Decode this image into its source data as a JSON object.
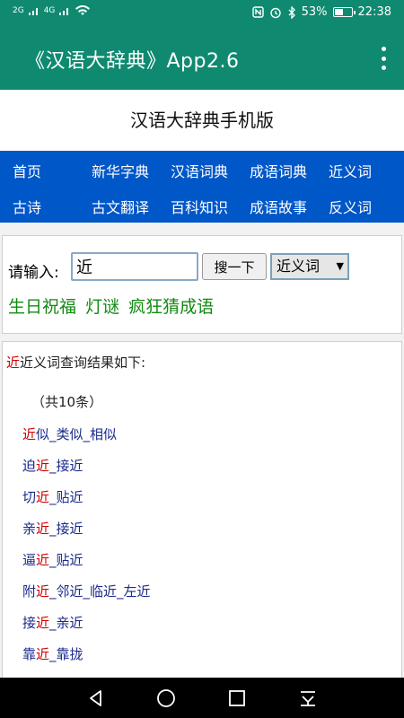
{
  "status_bar": {
    "left_indicators": [
      "2G",
      "4G"
    ],
    "battery_percent": "53%",
    "battery_level": 0.53,
    "time": "22:38"
  },
  "app_bar": {
    "title": "《汉语大辞典》App2.6"
  },
  "site_header": {
    "title": "汉语大辞典手机版"
  },
  "nav": {
    "row1": [
      "首页",
      "新华字典",
      "汉语词典",
      "成语词典",
      "近义词"
    ],
    "row2": [
      "古诗",
      "古文翻译",
      "百科知识",
      "成语故事",
      "反义词"
    ]
  },
  "search": {
    "label": "请输入:",
    "value": "近",
    "button_label": "搜一下",
    "selected_option": "近义词",
    "links": [
      "生日祝福",
      "灯谜",
      "疯狂猜成语"
    ]
  },
  "results": {
    "keyword": "近",
    "title_suffix": "近义词查询结果如下:",
    "count_text": "（共10条）",
    "items": [
      [
        {
          "t": "近",
          "k": true
        },
        {
          "t": "似_类似_相似",
          "k": false
        }
      ],
      [
        {
          "t": "迫",
          "k": false
        },
        {
          "t": "近",
          "k": true
        },
        {
          "t": "_接近",
          "k": false
        }
      ],
      [
        {
          "t": "切",
          "k": false
        },
        {
          "t": "近",
          "k": true
        },
        {
          "t": "_贴近",
          "k": false
        }
      ],
      [
        {
          "t": "亲",
          "k": false
        },
        {
          "t": "近",
          "k": true
        },
        {
          "t": "_接近",
          "k": false
        }
      ],
      [
        {
          "t": "逼",
          "k": false
        },
        {
          "t": "近",
          "k": true
        },
        {
          "t": "_贴近",
          "k": false
        }
      ],
      [
        {
          "t": "附",
          "k": false
        },
        {
          "t": "近",
          "k": true
        },
        {
          "t": "_邻近_临近_左近",
          "k": false
        }
      ],
      [
        {
          "t": "接",
          "k": false
        },
        {
          "t": "近",
          "k": true
        },
        {
          "t": "_亲近",
          "k": false
        }
      ],
      [
        {
          "t": "靠",
          "k": false
        },
        {
          "t": "近",
          "k": true
        },
        {
          "t": "_靠拢",
          "k": false
        }
      ]
    ]
  },
  "colors": {
    "primary": "#0f8a70",
    "nav_bg": "#0057c8",
    "link_green": "#128a12",
    "keyword_red": "#cc0000",
    "result_blue": "#1a2a8a"
  },
  "icons": {
    "status": [
      "nfc-icon",
      "alarm-icon",
      "bluetooth-icon",
      "battery-icon"
    ],
    "navbar": [
      "back-icon",
      "home-icon",
      "recents-icon",
      "notification-pull-icon"
    ]
  }
}
